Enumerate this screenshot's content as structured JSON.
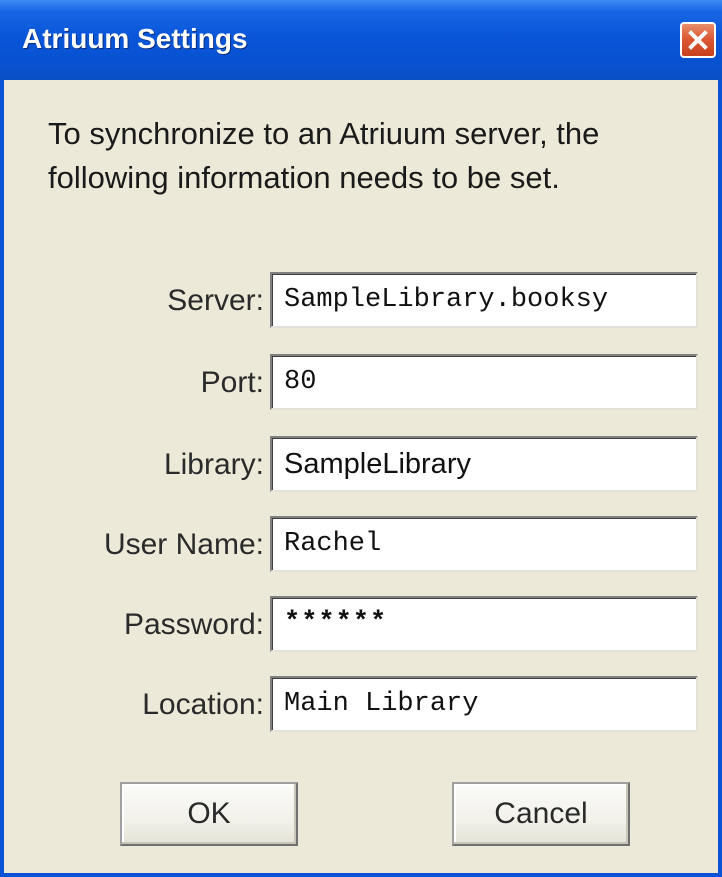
{
  "window": {
    "title": "Atriuum Settings",
    "close_icon": "close-icon",
    "accent": "#0a53d6",
    "close_color": "#dc5a34"
  },
  "intro": {
    "text": "To synchronize to an Atriuum server, the following information needs to be set."
  },
  "form": {
    "server": {
      "label": "Server:",
      "value": "SampleLibrary.booksy"
    },
    "port": {
      "label": "Port:",
      "value": "80"
    },
    "library": {
      "label": "Library:",
      "value": "SampleLibrary"
    },
    "username": {
      "label": "User Name:",
      "value": "Rachel"
    },
    "password": {
      "label": "Password:",
      "value": "******"
    },
    "location": {
      "label": "Location:",
      "value": "Main Library"
    }
  },
  "buttons": {
    "ok": "OK",
    "cancel": "Cancel"
  }
}
